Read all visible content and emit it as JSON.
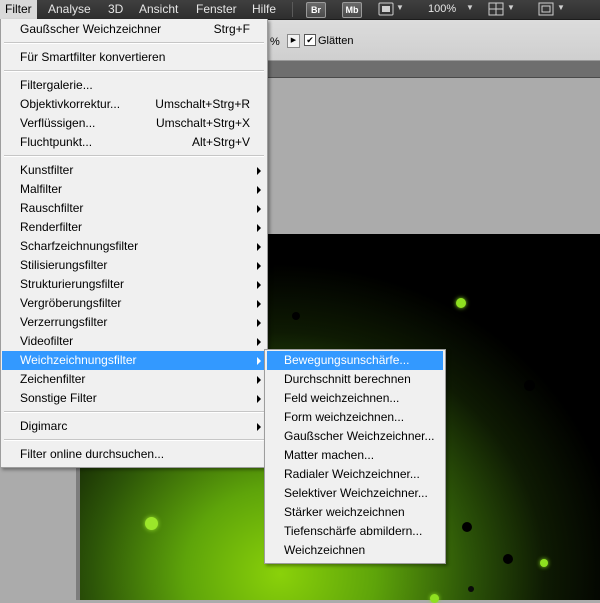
{
  "menubar": {
    "items": [
      {
        "label": "Filter",
        "active": true
      },
      {
        "label": "Analyse"
      },
      {
        "label": "3D"
      },
      {
        "label": "Ansicht"
      },
      {
        "label": "Fenster"
      },
      {
        "label": "Hilfe"
      }
    ],
    "bridge_label": "Br",
    "minibridge_label": "Mb",
    "zoom": "100%"
  },
  "options_bar": {
    "percent_suffix": "%",
    "glatten_label": "Glätten",
    "glatten_checked": true
  },
  "filter_menu": {
    "items": [
      {
        "label": "Gaußscher Weichzeichner",
        "shortcut": "Strg+F"
      },
      {
        "separator": true
      },
      {
        "label": "Für Smartfilter konvertieren"
      },
      {
        "separator": true
      },
      {
        "label": "Filtergalerie..."
      },
      {
        "label": "Objektivkorrektur...",
        "shortcut": "Umschalt+Strg+R"
      },
      {
        "label": "Verflüssigen...",
        "shortcut": "Umschalt+Strg+X"
      },
      {
        "label": "Fluchtpunkt...",
        "shortcut": "Alt+Strg+V"
      },
      {
        "separator": true
      },
      {
        "label": "Kunstfilter",
        "submenu": true
      },
      {
        "label": "Malfilter",
        "submenu": true
      },
      {
        "label": "Rauschfilter",
        "submenu": true
      },
      {
        "label": "Renderfilter",
        "submenu": true
      },
      {
        "label": "Scharfzeichnungsfilter",
        "submenu": true
      },
      {
        "label": "Stilisierungsfilter",
        "submenu": true
      },
      {
        "label": "Strukturierungsfilter",
        "submenu": true
      },
      {
        "label": "Vergröberungsfilter",
        "submenu": true
      },
      {
        "label": "Verzerrungsfilter",
        "submenu": true
      },
      {
        "label": "Videofilter",
        "submenu": true
      },
      {
        "label": "Weichzeichnungsfilter",
        "submenu": true,
        "highlighted": true
      },
      {
        "label": "Zeichenfilter",
        "submenu": true
      },
      {
        "label": "Sonstige Filter",
        "submenu": true
      },
      {
        "separator": true
      },
      {
        "label": "Digimarc",
        "submenu": true
      },
      {
        "separator": true
      },
      {
        "label": "Filter online durchsuchen..."
      }
    ]
  },
  "blur_submenu": {
    "items": [
      {
        "label": "Bewegungsunschärfe...",
        "highlighted": true
      },
      {
        "label": "Durchschnitt berechnen"
      },
      {
        "label": "Feld weichzeichnen..."
      },
      {
        "label": "Form weichzeichnen..."
      },
      {
        "label": "Gaußscher Weichzeichner..."
      },
      {
        "label": "Matter machen..."
      },
      {
        "label": "Radialer Weichzeichner..."
      },
      {
        "label": "Selektiver Weichzeichner..."
      },
      {
        "label": "Stärker weichzeichnen"
      },
      {
        "label": "Tiefenschärfe abmildern..."
      },
      {
        "label": "Weichzeichnen"
      }
    ]
  },
  "colors": {
    "highlight": "#3399ff",
    "menu_bg": "#f0f0f0",
    "canvas_green": "#8ad10a"
  }
}
